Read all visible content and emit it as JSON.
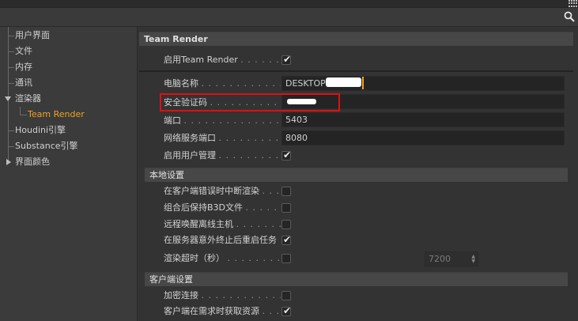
{
  "sidebar": {
    "items": [
      {
        "label": "用户界面"
      },
      {
        "label": "文件"
      },
      {
        "label": "内存"
      },
      {
        "label": "通讯"
      },
      {
        "label": "渲染器"
      },
      {
        "label": "Team Render"
      },
      {
        "label": "Houdini引擎"
      },
      {
        "label": "Substance引擎"
      },
      {
        "label": "界面颜色"
      }
    ]
  },
  "main": {
    "title": "Team Render",
    "enable_team_render": {
      "label": "启用Team Render",
      "dots": ". . . . . . . . . .",
      "checked": true
    },
    "computer_name": {
      "label": "电脑名称",
      "dots": ". . . . . . . . . . . . . . . . .",
      "value": "DESKTOP"
    },
    "security_token": {
      "label": "安全验证码",
      "dots": ". . . . . . . . . . . . . . . .",
      "value": ""
    },
    "port": {
      "label": "端口",
      "dots": ". . . . . . . . . . . . . . . . . . . . .",
      "value": "5403"
    },
    "web_port": {
      "label": "网络服务端口",
      "dots": ". . . . . . . . . . . . . .",
      "value": "8080"
    },
    "user_management": {
      "label": "启用用户管理",
      "dots": ". . . . . . . . . . . . . . .",
      "checked": true
    },
    "local_settings": {
      "header": "本地设置",
      "abort_on_client_error": {
        "label": "在客户端错误时中断渲染",
        "dots": ". . . . .",
        "checked": false
      },
      "keep_b3d": {
        "label": "组合后保持B3D文件",
        "dots": ". . . . . . . . . .",
        "checked": false
      },
      "wake_offline": {
        "label": "远程唤醒离线主机",
        "dots": ". . . . . . . . . . .",
        "checked": false
      },
      "restart_on_crash": {
        "label": "在服务器意外终止后重启任务",
        "dots": "",
        "checked": true
      },
      "render_timeout": {
        "label": "渲染超时（秒）",
        "dots": ". . . . . . . . . . . .",
        "checked": false,
        "value": "7200"
      }
    },
    "client_settings": {
      "header": "客户端设置",
      "encrypt": {
        "label": "加密连接",
        "dots": ". . . . . . . . . . . . . . . . .",
        "checked": false
      },
      "fetch_assets": {
        "label": "客户端在需求时获取资源",
        "dots": ". . . . . .",
        "checked": true
      }
    }
  },
  "colors": {
    "accent": "#f0a020",
    "highlight": "#e01010",
    "background": "#333333"
  }
}
